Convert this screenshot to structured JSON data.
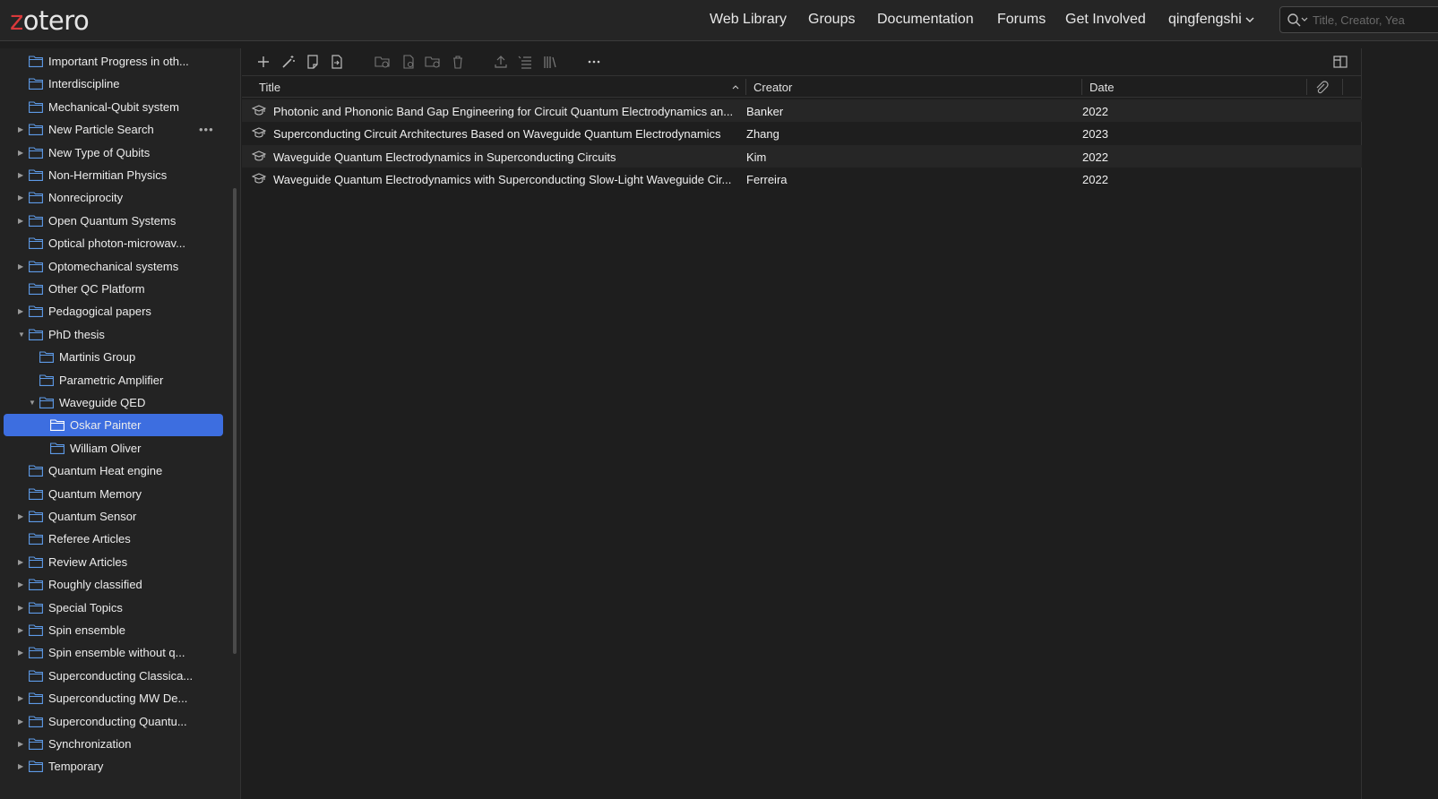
{
  "app": {
    "logo_first_letter": "z",
    "logo_rest": "otero",
    "accent": "#d9393b",
    "selection_color": "#3d6ee0"
  },
  "nav": {
    "web_library": "Web Library",
    "groups": "Groups",
    "documentation": "Documentation",
    "forums": "Forums",
    "get_involved": "Get Involved",
    "user": "qingfengshi"
  },
  "search": {
    "placeholder": "Title, Creator, Yea"
  },
  "sidebar": {
    "items": [
      {
        "label": "Important Progress in oth...",
        "twisty": ""
      },
      {
        "label": "Interdiscipline",
        "twisty": ""
      },
      {
        "label": "Mechanical-Qubit system",
        "twisty": ""
      },
      {
        "label": "New Particle Search",
        "twisty": "collapsed",
        "more": "•••"
      },
      {
        "label": "New Type of Qubits",
        "twisty": "collapsed"
      },
      {
        "label": "Non-Hermitian Physics",
        "twisty": "collapsed"
      },
      {
        "label": "Nonreciprocity",
        "twisty": "collapsed"
      },
      {
        "label": "Open Quantum Systems",
        "twisty": "collapsed"
      },
      {
        "label": "Optical photon-microwav...",
        "twisty": ""
      },
      {
        "label": "Optomechanical systems",
        "twisty": "collapsed"
      },
      {
        "label": "Other QC Platform",
        "twisty": ""
      },
      {
        "label": "Pedagogical papers",
        "twisty": "collapsed"
      },
      {
        "label": "PhD thesis",
        "twisty": "expanded"
      },
      {
        "label": "Martinis Group",
        "twisty": ""
      },
      {
        "label": "Parametric Amplifier",
        "twisty": ""
      },
      {
        "label": "Waveguide QED",
        "twisty": "expanded"
      },
      {
        "label": "Oskar Painter",
        "twisty": "",
        "selected": true
      },
      {
        "label": "William Oliver",
        "twisty": ""
      },
      {
        "label": "Quantum Heat engine",
        "twisty": ""
      },
      {
        "label": "Quantum Memory",
        "twisty": ""
      },
      {
        "label": "Quantum Sensor",
        "twisty": "collapsed"
      },
      {
        "label": "Referee Articles",
        "twisty": ""
      },
      {
        "label": "Review Articles",
        "twisty": "collapsed"
      },
      {
        "label": "Roughly classified",
        "twisty": "collapsed"
      },
      {
        "label": "Special Topics",
        "twisty": "collapsed"
      },
      {
        "label": "Spin ensemble",
        "twisty": "collapsed"
      },
      {
        "label": "Spin ensemble without q...",
        "twisty": "collapsed"
      },
      {
        "label": "Superconducting Classica...",
        "twisty": ""
      },
      {
        "label": "Superconducting MW De...",
        "twisty": "collapsed"
      },
      {
        "label": "Superconducting Quantu...",
        "twisty": "collapsed"
      },
      {
        "label": "Synchronization",
        "twisty": "collapsed"
      },
      {
        "label": "Temporary",
        "twisty": "collapsed"
      }
    ]
  },
  "toolbar": {
    "icons": [
      "new-item-icon",
      "magic-wand-icon",
      "new-note-icon",
      "add-attachment-icon",
      "new-collection-icon",
      "duplicate-icon",
      "move-to-collection-icon",
      "trash-icon",
      "export-icon",
      "cite-icon",
      "bibliography-icon",
      "more-icon",
      "toggle-item-pane-icon"
    ]
  },
  "table": {
    "headers": {
      "title": "Title",
      "creator": "Creator",
      "date": "Date"
    },
    "sort_indicator": "^",
    "rows": [
      {
        "title": "Photonic and Phononic Band Gap Engineering for Circuit Quantum Electrodynamics an...",
        "creator": "Banker",
        "date": "2022"
      },
      {
        "title": "Superconducting Circuit Architectures Based on Waveguide Quantum Electrodynamics",
        "creator": "Zhang",
        "date": "2023"
      },
      {
        "title": "Waveguide Quantum Electrodynamics in Superconducting Circuits",
        "creator": "Kim",
        "date": "2022"
      },
      {
        "title": "Waveguide Quantum Electrodynamics with Superconducting Slow-Light Waveguide Cir...",
        "creator": "Ferreira",
        "date": "2022"
      }
    ]
  }
}
